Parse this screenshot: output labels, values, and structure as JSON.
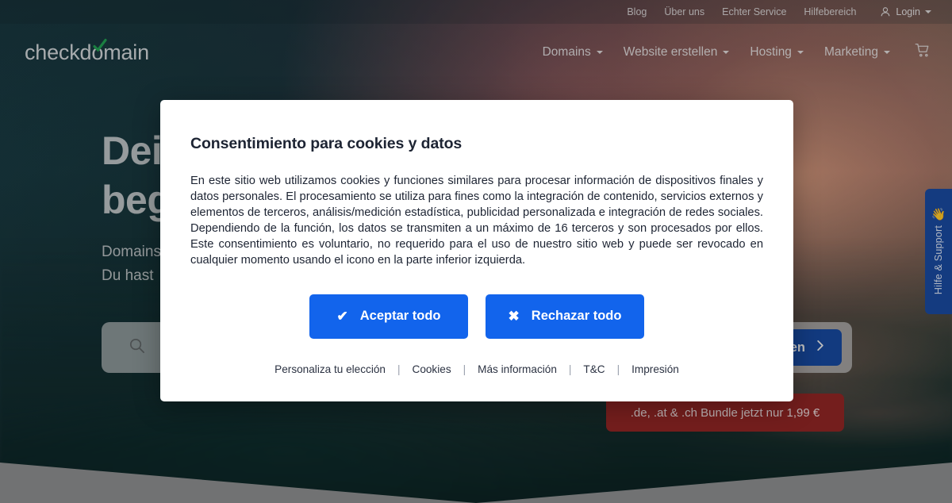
{
  "topbar": {
    "links": [
      {
        "label": "Blog"
      },
      {
        "label": "Über uns"
      },
      {
        "label": "Echter Service"
      },
      {
        "label": "Hilfebereich"
      }
    ],
    "login_label": "Login",
    "user_icon": "user-icon",
    "caret_icon": "chevron-down-icon"
  },
  "brand": {
    "name_before": "checkd",
    "name_o": "o",
    "name_after": "main",
    "check_color": "#1f9c4d",
    "logo_color": "#cfd3d4"
  },
  "mainnav": {
    "items": [
      {
        "label": "Domains",
        "has_caret": true
      },
      {
        "label": "Website erstellen",
        "has_caret": true
      },
      {
        "label": "Hosting",
        "has_caret": true
      },
      {
        "label": "Marketing",
        "has_caret": true
      }
    ],
    "cart_icon": "shopping-cart-icon"
  },
  "hero": {
    "title_line1": "Dein",
    "title_line2": "beg",
    "sub_line1": "Domains",
    "sub_line2": "Du hast"
  },
  "search": {
    "icon": "search-icon",
    "placeholder": "",
    "value": "",
    "button_label": "ken",
    "button_icon": "chevron-right-icon",
    "button_color": "#15459a"
  },
  "promo": {
    "text": ".de, .at & .ch Bundle jetzt nur 1,99 €",
    "color": "#8f2220"
  },
  "support_tab": {
    "label": "Hilfe & Support",
    "icon": "waving-hand-icon",
    "color": "#17479c"
  },
  "modal": {
    "title": "Consentimiento para cookies y datos",
    "body": "En este sitio web utilizamos cookies y funciones similares para procesar información de dispositivos finales y datos personales. El procesamiento se utiliza para fines como la integración de contenido, servicios externos y elementos de terceros, análisis/medición estadística, publicidad personalizada e integración de redes sociales. Dependiendo de la función, los datos se transmiten a un máximo de 16 terceros y son procesados por ellos. Este consentimiento es voluntario, no requerido para el uso de nuestro sitio web y puede ser revocado en cualquier momento usando el icono en la parte inferior izquierda.",
    "accept_label": "Aceptar todo",
    "accept_icon": "check-icon",
    "reject_label": "Rechazar todo",
    "reject_icon": "close-icon",
    "button_color": "#1264ec",
    "links": [
      {
        "label": "Personaliza tu elección"
      },
      {
        "label": "Cookies"
      },
      {
        "label": "Más información"
      },
      {
        "label": "T&C"
      },
      {
        "label": "Impresión"
      }
    ],
    "separator": "|"
  }
}
